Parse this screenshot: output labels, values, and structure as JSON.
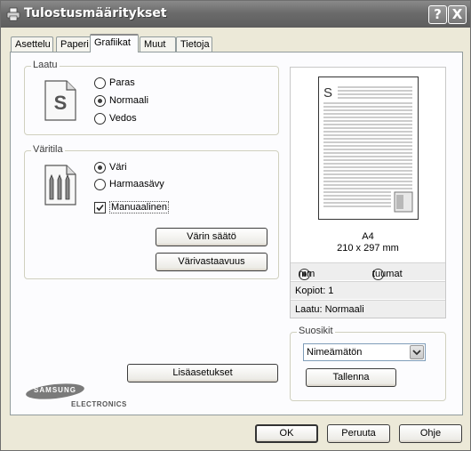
{
  "window": {
    "title": "Tulostusmääritykset",
    "help_button": "?",
    "close_button": "X"
  },
  "tabs": [
    {
      "label": "Asettelu"
    },
    {
      "label": "Paperi"
    },
    {
      "label": "Grafiikat"
    },
    {
      "label": "Muut"
    },
    {
      "label": "Tietoja"
    }
  ],
  "active_tab": "Grafiikat",
  "quality": {
    "label": "Laatu",
    "options": [
      "Paras",
      "Normaali",
      "Vedos"
    ],
    "selected": "Normaali"
  },
  "color_mode": {
    "label": "Väritila",
    "options": [
      "Väri",
      "Harmaasävy"
    ],
    "selected": "Väri",
    "manual_label": "Manuaalinen",
    "manual_checked": true,
    "adjust_button": "Värin säätö",
    "match_button": "Värivastaavuus"
  },
  "advanced_button": "Lisäasetukset",
  "preview": {
    "page_letter": "S",
    "paper_name": "A4",
    "paper_size": "210 x 297 mm",
    "unit_options": [
      "mm",
      "tuumat"
    ],
    "unit_selected": "mm",
    "copies": "Kopiot: 1",
    "quality": "Laatu: Normaali"
  },
  "favorites": {
    "label": "Suosikit",
    "selected": "Nimeämätön",
    "save_button": "Tallenna"
  },
  "brand": {
    "name": "SAMSUNG",
    "sub": "ELECTRONICS"
  },
  "footer": {
    "ok": "OK",
    "cancel": "Peruuta",
    "help": "Ohje"
  }
}
